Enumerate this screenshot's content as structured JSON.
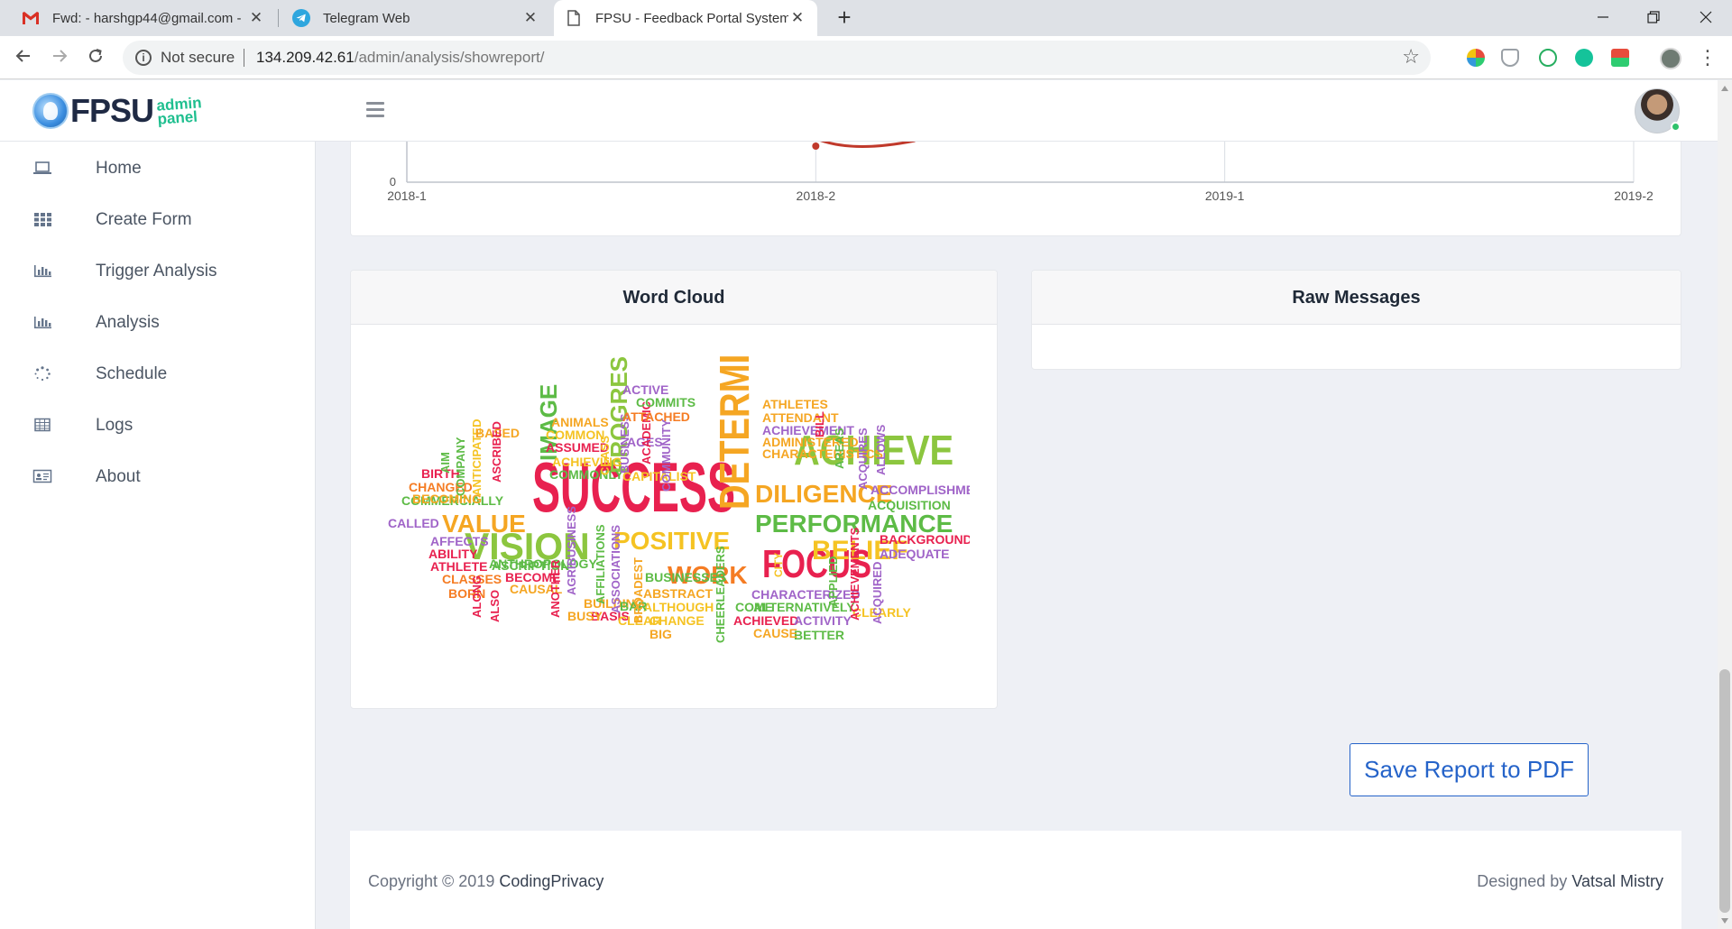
{
  "browser": {
    "tabs": [
      {
        "title": "Fwd: - harshgp44@gmail.com - G",
        "icon": "gmail-icon",
        "active": false
      },
      {
        "title": "Telegram Web",
        "icon": "telegram-icon",
        "active": false
      },
      {
        "title": "FPSU - Feedback Portal System fo",
        "icon": "document-icon",
        "active": true
      }
    ],
    "close_glyph": "✕",
    "new_tab_glyph": "+",
    "address": {
      "security_label": "Not secure",
      "host": "134.209.42.61",
      "path": "/admin/analysis/showreport/"
    }
  },
  "header": {
    "logo_text": "FPSU",
    "logo_sub_1": "admin",
    "logo_sub_2": "panel",
    "avatar_status_color": "#2fc26b"
  },
  "sidebar": {
    "items": [
      {
        "label": "Home",
        "icon": "laptop-icon"
      },
      {
        "label": "Create Form",
        "icon": "grid-icon"
      },
      {
        "label": "Trigger Analysis",
        "icon": "bar-chart-icon"
      },
      {
        "label": "Analysis",
        "icon": "bar-chart-icon"
      },
      {
        "label": "Schedule",
        "icon": "spinner-icon"
      },
      {
        "label": "Logs",
        "icon": "table-icon"
      },
      {
        "label": "About",
        "icon": "id-card-icon"
      }
    ]
  },
  "chart_data": {
    "type": "line",
    "categories": [
      "2018-1",
      "2018-2",
      "2019-1",
      "2019-2"
    ],
    "y_tick_labels": [
      "0"
    ],
    "series": [
      {
        "values": [
          null,
          0.1,
          null,
          null
        ],
        "color": "#c0392b"
      }
    ],
    "grid": true
  },
  "wordcloud": {
    "title": "Word Cloud",
    "words": [
      {
        "text": "SUCCESS",
        "color": "#e8214f"
      },
      {
        "text": "DETERMINED",
        "color": "#f5a623"
      },
      {
        "text": "ACHIEVE",
        "color": "#8cc63f"
      },
      {
        "text": "FOCUS",
        "color": "#e8214f"
      },
      {
        "text": "VISION",
        "color": "#8cc63f"
      },
      {
        "text": "PERFORMANCE",
        "color": "#5dbb46"
      },
      {
        "text": "DILIGENCE",
        "color": "#f5a623"
      },
      {
        "text": "POSITIVE",
        "color": "#f5c323"
      },
      {
        "text": "PROGRESS",
        "color": "#8cc63f"
      },
      {
        "text": "BELIEF",
        "color": "#f5c323"
      },
      {
        "text": "VALUE",
        "color": "#f5a623"
      },
      {
        "text": "WORK",
        "color": "#f57c23"
      },
      {
        "text": "IMAGE",
        "color": "#5dbb46"
      },
      {
        "text": "ACCOMPLISHMENT",
        "color": "#a064c8"
      },
      {
        "text": "ATHLETES",
        "color": "#f5a623"
      },
      {
        "text": "ACHIEVEMENT",
        "color": "#a064c8"
      },
      {
        "text": "ATTENDANT",
        "color": "#f5a623"
      },
      {
        "text": "ADMINISTERED",
        "color": "#f5a623"
      },
      {
        "text": "CHARACTERISTICS",
        "color": "#f5a623"
      },
      {
        "text": "ACQUISITION",
        "color": "#5dbb46"
      },
      {
        "text": "BACKGROUND",
        "color": "#e8214f"
      },
      {
        "text": "ADEQUATE",
        "color": "#a064c8"
      },
      {
        "text": "COMMERCIALLY",
        "color": "#5dbb46"
      },
      {
        "text": "ANTHROPOLOGY",
        "color": "#5dbb46"
      },
      {
        "text": "ALTERNATIVELY",
        "color": "#5dbb46"
      },
      {
        "text": "CHARACTERIZED",
        "color": "#a064c8"
      },
      {
        "text": "CHEERLEADERS",
        "color": "#5dbb46"
      },
      {
        "text": "BUSINESSES",
        "color": "#5dbb46"
      },
      {
        "text": "ACHIEVED",
        "color": "#e8214f"
      },
      {
        "text": "ACTIVITY",
        "color": "#a064c8"
      },
      {
        "text": "CLEARLY",
        "color": "#f5c323"
      },
      {
        "text": "BETTER",
        "color": "#5dbb46"
      },
      {
        "text": "CAUSE",
        "color": "#f5a623"
      },
      {
        "text": "COME",
        "color": "#5dbb46"
      },
      {
        "text": "ABSTRACT",
        "color": "#f5a623"
      },
      {
        "text": "ALTHOUGH",
        "color": "#f5c323"
      },
      {
        "text": "CHANGE",
        "color": "#f5c323"
      },
      {
        "text": "BIG",
        "color": "#f5a623"
      },
      {
        "text": "BUILDING",
        "color": "#f5a623"
      },
      {
        "text": "BASIS",
        "color": "#e8214f"
      },
      {
        "text": "BUSY",
        "color": "#f5a623"
      },
      {
        "text": "CLEAR",
        "color": "#f5c323"
      },
      {
        "text": "BAR",
        "color": "#5dbb46"
      },
      {
        "text": "CAUSAL",
        "color": "#f5a623"
      },
      {
        "text": "BECOME",
        "color": "#e8214f"
      },
      {
        "text": "ASCRIPTION",
        "color": "#5dbb46"
      },
      {
        "text": "CLASSES",
        "color": "#f57c23"
      },
      {
        "text": "ATHLETE",
        "color": "#e8214f"
      },
      {
        "text": "ABILITY",
        "color": "#e8214f"
      },
      {
        "text": "AFFECTS",
        "color": "#a064c8"
      },
      {
        "text": "CALLED",
        "color": "#a064c8"
      },
      {
        "text": "BORN",
        "color": "#f57c23"
      },
      {
        "text": "ALONG",
        "color": "#e8214f"
      },
      {
        "text": "ALSO",
        "color": "#e8214f"
      },
      {
        "text": "ANOTHER",
        "color": "#e8214f"
      },
      {
        "text": "AGRIBUSINESS",
        "color": "#a064c8"
      },
      {
        "text": "AFFILIATIONS",
        "color": "#5dbb46"
      },
      {
        "text": "ASSOCIATIONS",
        "color": "#a064c8"
      },
      {
        "text": "BROADEST",
        "color": "#f5a623"
      },
      {
        "text": "CITY",
        "color": "#f5c323"
      },
      {
        "text": "APPLIED",
        "color": "#5dbb46"
      },
      {
        "text": "ACHIEVEMENTS",
        "color": "#e8214f"
      },
      {
        "text": "ACQUIRED",
        "color": "#a064c8"
      },
      {
        "text": "CHANGED",
        "color": "#f57c23"
      },
      {
        "text": "BECOMING",
        "color": "#f5a623"
      },
      {
        "text": "BIRTH",
        "color": "#e8214f"
      },
      {
        "text": "AIM",
        "color": "#5dbb46"
      },
      {
        "text": "COMPANY",
        "color": "#5dbb46"
      },
      {
        "text": "ANTICIPATED",
        "color": "#f5c323"
      },
      {
        "text": "BASED",
        "color": "#f5a623"
      },
      {
        "text": "ASCRIBED",
        "color": "#e8214f"
      },
      {
        "text": "ANIMALS",
        "color": "#f5a623"
      },
      {
        "text": "COMMON",
        "color": "#f5c323"
      },
      {
        "text": "ASSUMED",
        "color": "#e8214f"
      },
      {
        "text": "ACHIEVING",
        "color": "#f5c323"
      },
      {
        "text": "COMMONLY",
        "color": "#5dbb46"
      },
      {
        "text": "CLASS",
        "color": "#f5c323"
      },
      {
        "text": "AGES",
        "color": "#a064c8"
      },
      {
        "text": "BUSINESS",
        "color": "#a064c8"
      },
      {
        "text": "ACADEMIC",
        "color": "#e8214f"
      },
      {
        "text": "CAPITALIST",
        "color": "#f5c323"
      },
      {
        "text": "ACTIVE",
        "color": "#a064c8"
      },
      {
        "text": "COMMITS",
        "color": "#5dbb46"
      },
      {
        "text": "ATTACHED",
        "color": "#f57c23"
      },
      {
        "text": "COMMUNITY",
        "color": "#a064c8"
      },
      {
        "text": "BILL",
        "color": "#e8214f"
      },
      {
        "text": "AREAS",
        "color": "#5dbb46"
      },
      {
        "text": "ACQUIRES",
        "color": "#a064c8"
      },
      {
        "text": "ALLOWS",
        "color": "#a064c8"
      }
    ]
  },
  "raw_messages": {
    "title": "Raw Messages"
  },
  "actions": {
    "save_pdf": "Save Report to PDF"
  },
  "footer": {
    "copyright_prefix": "Copyright © 2019 ",
    "copyright_link": "CodingPrivacy",
    "designed_prefix": "Designed by ",
    "designer": "Vatsal Mistry"
  }
}
